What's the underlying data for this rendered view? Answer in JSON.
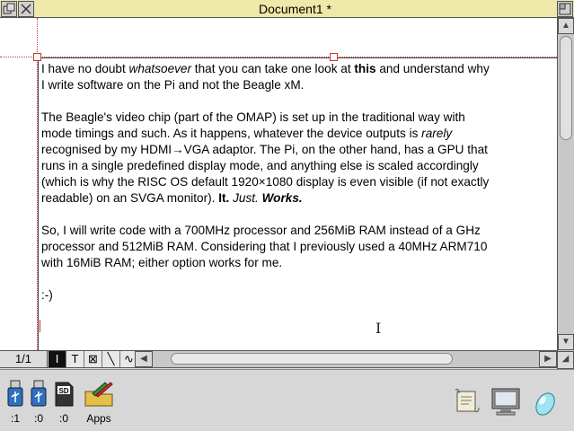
{
  "window": {
    "title": "Document1 *",
    "buttons": {
      "back_icon": "back-icon",
      "close_icon": "close-icon",
      "toggle_size_icon": "toggle-size-icon"
    }
  },
  "document": {
    "paragraphs": [
      [
        "I have no doubt ",
        {
          "i": "whatsoever"
        },
        " that you can take one look at ",
        {
          "b": "this"
        },
        " and understand why I write software on the Pi and not the Beagle xM."
      ],
      [
        "The Beagle's video chip (part of the OMAP) is set up in the traditional way with mode timings and such. As it happens, whatever the device outputs is ",
        {
          "i": "rarely"
        },
        " recognised by my HDMI→VGA adaptor. The Pi, on the other hand, has a GPU that runs in a single predefined display mode, and anything else is scaled accordingly (which is why the RISC OS default 1920×1080 display is even visible (if not exactly readable) on an SVGA monitor). ",
        {
          "b": "It."
        },
        " ",
        {
          "i": "Just."
        },
        " ",
        {
          "bi": "Works."
        }
      ],
      [
        "So, I will write code with a 700MHz processor and 256MiB RAM instead of a GHz processor and 512MiB RAM. Considering that I previously used a 40MHz ARM710 with 16MiB RAM; either option works for me."
      ],
      [
        ":-)"
      ]
    ]
  },
  "toolbar": {
    "page": "1/1",
    "tools": [
      {
        "name": "text-cursor-tool",
        "glyph": "I"
      },
      {
        "name": "text-tool",
        "glyph": "T"
      },
      {
        "name": "frame-tool",
        "glyph": "⊠"
      },
      {
        "name": "line-tool",
        "glyph": "╲"
      },
      {
        "name": "pattern-tool",
        "glyph": "∿"
      }
    ]
  },
  "iconbar": {
    "left": [
      {
        "name": "usb-drive-1",
        "label": ":1",
        "icon": "usb-icon"
      },
      {
        "name": "usb-drive-0",
        "label": ":0",
        "icon": "usb-icon"
      },
      {
        "name": "sd-card-drive",
        "label": ":0",
        "icon": "sd-card-icon"
      },
      {
        "name": "apps",
        "label": "Apps",
        "icon": "apps-icon"
      }
    ],
    "right": [
      {
        "name": "app-scroll",
        "icon": "scroll-icon"
      },
      {
        "name": "display-manager",
        "icon": "monitor-icon"
      },
      {
        "name": "task-manager",
        "icon": "acorn-icon"
      }
    ]
  },
  "colors": {
    "title_bar": "#eee9a8",
    "guide": "#cc3333",
    "paper": "#ffffff"
  }
}
